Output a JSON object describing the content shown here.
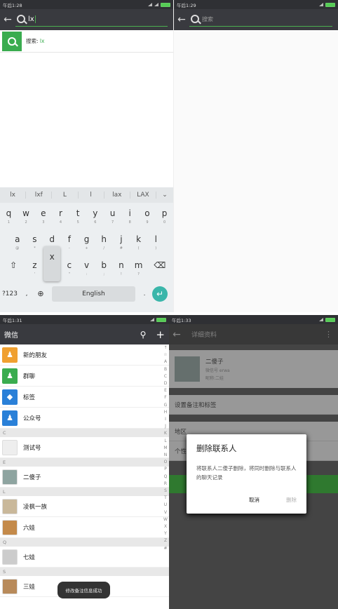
{
  "panel1": {
    "time": "午后1:28",
    "search_text": "lx",
    "result_prefix": "搜索:",
    "result_term": "lx",
    "suggestions": [
      "lx",
      "lxf",
      "L",
      "l",
      "lax",
      "LAX"
    ],
    "row1": [
      [
        "q",
        "1"
      ],
      [
        "w",
        "2"
      ],
      [
        "e",
        "3"
      ],
      [
        "r",
        "4"
      ],
      [
        "t",
        "5"
      ],
      [
        "y",
        "6"
      ],
      [
        "u",
        "7"
      ],
      [
        "i",
        "8"
      ],
      [
        "o",
        "9"
      ],
      [
        "p",
        "0"
      ]
    ],
    "row2": [
      [
        "a",
        "@"
      ],
      [
        "s",
        "*"
      ],
      [
        "d",
        ""
      ],
      [
        "f",
        "-"
      ],
      [
        "g",
        "+"
      ],
      [
        "h",
        "/"
      ],
      [
        "j",
        "#"
      ],
      [
        "k",
        "("
      ],
      [
        "l",
        ")"
      ]
    ],
    "row3": [
      [
        "z",
        "'"
      ],
      [
        "x",
        ""
      ],
      [
        "c",
        "\""
      ],
      [
        "v",
        ":"
      ],
      [
        "b",
        ";"
      ],
      [
        "n",
        "!"
      ],
      [
        "m",
        "?"
      ]
    ],
    "pressed_key": "x",
    "symbols_key": "?123",
    "comma_key": ",",
    "space_label": "English",
    "period_key": "."
  },
  "panel2": {
    "time": "午后1:29",
    "placeholder": "搜索"
  },
  "panel3": {
    "time": "午后1:31",
    "title": "微信",
    "top_items": [
      {
        "label": "新的朋友",
        "color": "#f0a030",
        "icon": "person-add-icon",
        "glyph": "♟"
      },
      {
        "label": "群聊",
        "color": "#3aac4f",
        "icon": "group-icon",
        "glyph": "♟"
      },
      {
        "label": "标签",
        "color": "#2a80d8",
        "icon": "tag-icon",
        "glyph": "◆"
      },
      {
        "label": "公众号",
        "color": "#2a80d8",
        "icon": "official-account-icon",
        "glyph": "♟"
      }
    ],
    "sections": [
      {
        "letter": "C",
        "contacts": [
          {
            "name": "测试号",
            "avatar": "#eee"
          }
        ]
      },
      {
        "letter": "E",
        "contacts": [
          {
            "name": "二傻子",
            "avatar": "#8ea4a0"
          }
        ]
      },
      {
        "letter": "L",
        "contacts": [
          {
            "name": "凌枫一族",
            "avatar": "#c9b89a"
          },
          {
            "name": "六娃",
            "avatar": "#c48a4a"
          }
        ]
      },
      {
        "letter": "Q",
        "contacts": [
          {
            "name": "七娃",
            "avatar": "#ccc"
          }
        ]
      },
      {
        "letter": "S",
        "contacts": [
          {
            "name": "三娃",
            "avatar": "#b88a5a"
          }
        ]
      }
    ],
    "alphabet": [
      "↑",
      "☆",
      "A",
      "B",
      "C",
      "D",
      "E",
      "F",
      "G",
      "H",
      "I",
      "J",
      "K",
      "L",
      "M",
      "N",
      "O",
      "P",
      "Q",
      "R",
      "S",
      "T",
      "U",
      "V",
      "W",
      "X",
      "Y",
      "Z",
      "#"
    ],
    "toast": "修改备注信息成功"
  },
  "panel4": {
    "time": "午后1:33",
    "title": "详细资料",
    "profile_name": "二傻子",
    "profile_line1": "微信号 erwa",
    "profile_line2": "昵称:二娃",
    "row_remark": "设置备注和标签",
    "row_region": "地区",
    "row_sign": "个性",
    "dialog_title": "删除联系人",
    "dialog_msg": "将联系人二傻子删除，将同时删除与联系人的聊天记录",
    "cancel_label": "取消",
    "delete_label": "删除"
  }
}
